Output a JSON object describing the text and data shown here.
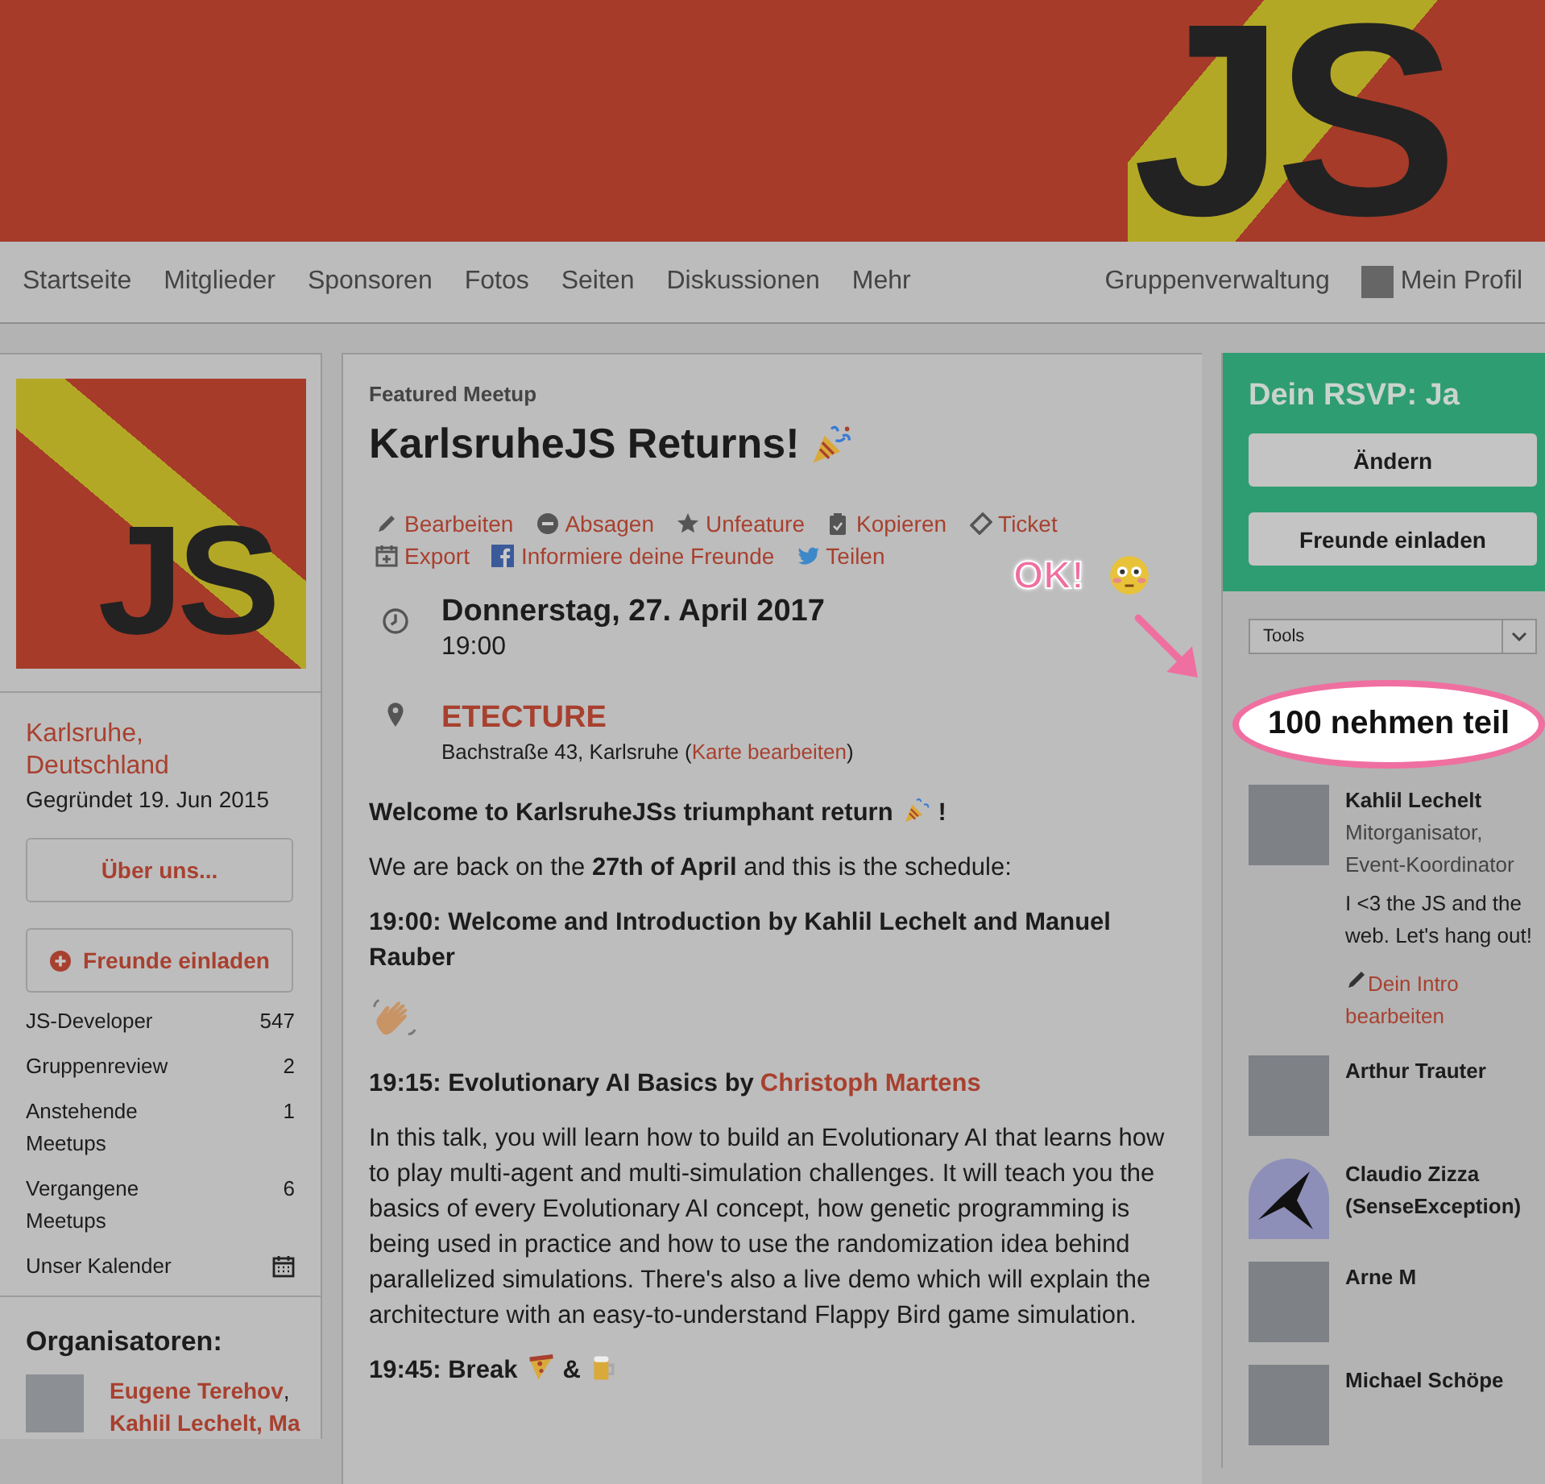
{
  "banner": {
    "logo_text": "JS"
  },
  "nav": {
    "items": [
      "Startseite",
      "Mitglieder",
      "Sponsoren",
      "Fotos",
      "Seiten",
      "Diskussionen",
      "Mehr"
    ],
    "admin": "Gruppenverwaltung",
    "profile": "Mein Profil"
  },
  "group": {
    "logo_text": "JS",
    "location": "Karlsruhe, Deutschland",
    "founded": "Gegründet 19. Jun 2015",
    "about_button": "Über uns...",
    "invite_button": "Freunde einladen",
    "stats": [
      {
        "kind": "count",
        "label": "JS-Developer",
        "value": "547"
      },
      {
        "kind": "count",
        "label": "Gruppenreview",
        "value": "2"
      },
      {
        "kind": "count",
        "label": "Anstehende Meetups",
        "value": "1"
      },
      {
        "kind": "count",
        "label": "Vergangene Meetups",
        "value": "6"
      },
      {
        "kind": "calendar",
        "label": "Unser Kalender"
      }
    ],
    "organizers": {
      "title": "Organisatoren:",
      "people": [
        "Eugene Terehov",
        "Kahlil Lechelt, Ma"
      ],
      "separator": ","
    }
  },
  "event": {
    "label": "Featured Meetup",
    "title": "KarlsruheJS Returns!",
    "actions": [
      {
        "kind": "edit",
        "label": "Bearbeiten"
      },
      {
        "kind": "cancel",
        "label": "Absagen"
      },
      {
        "kind": "unfeature",
        "label": "Unfeature"
      },
      {
        "kind": "copy",
        "label": "Kopieren"
      },
      {
        "kind": "ticket",
        "label": "Ticket"
      },
      {
        "kind": "export",
        "label": "Export"
      },
      {
        "kind": "facebook",
        "label": "Informiere deine Freunde"
      },
      {
        "kind": "twitter",
        "label": "Teilen"
      }
    ],
    "date": "Donnerstag, 27. April 2017",
    "time": "19:00",
    "venue": "ETECTURE",
    "address": "Bachstraße 43, Karlsruhe (",
    "map_link": "Karte bearbeiten",
    "address_end": ")",
    "blocks": [
      {
        "kind": "heading",
        "parts": [
          {
            "kind": "text",
            "text": "Welcome to KarlsruheJSs triumphant return"
          },
          {
            "kind": "party"
          },
          {
            "kind": "text",
            "text": "!"
          }
        ]
      },
      {
        "kind": "text",
        "text": "We are back on the **27th of April** and this is the schedule:"
      },
      {
        "kind": "heading",
        "parts": [
          {
            "kind": "text",
            "text": "19:00: Welcome and Introduction by Kahlil Lechelt and Manuel Rauber"
          }
        ]
      },
      {
        "kind": "emoji"
      },
      {
        "kind": "heading",
        "parts": [
          {
            "kind": "text",
            "text": "19:15: Evolutionary AI Basics by"
          },
          {
            "kind": "link",
            "text": "Christoph Martens"
          }
        ]
      },
      {
        "kind": "text",
        "text": "In this talk, you will learn how to build an Evolutionary AI that learns how to play multi-agent and multi-simulation challenges. It will teach you the basics of every Evolutionary AI concept, how genetic programming is being used in practice and how to use the randomization idea behind parallelized simulations. There's also a live demo which will explain the architecture with an easy-to-understand Flappy Bird game simulation."
      },
      {
        "kind": "heading",
        "parts": [
          {
            "kind": "text",
            "text": "19:45: Break"
          },
          {
            "kind": "pizza"
          },
          {
            "kind": "text",
            "text": "&"
          },
          {
            "kind": "beer"
          }
        ]
      }
    ]
  },
  "annotation": {
    "text": "OK!"
  },
  "rsvp": {
    "title": "Dein RSVP: Ja",
    "buttons": [
      "Ändern",
      "Freunde einladen"
    ]
  },
  "tools": {
    "value": "Tools"
  },
  "attendees": {
    "count": "100 nehmen teil",
    "people": [
      {
        "kind": "photo",
        "name": "Kahlil Lechelt",
        "role": "Mitorganisator, Event-Koordinator",
        "bio": "I <3 the JS and the web. Let's hang out!",
        "intro_link": "Dein Intro bearbeiten"
      },
      {
        "kind": "photo",
        "name": "Arthur Trauter"
      },
      {
        "kind": "bird",
        "name": "Claudio Zizza (SenseException)"
      },
      {
        "kind": "photo",
        "name": "Arne M"
      },
      {
        "kind": "photo",
        "name": "Michael Schöpe"
      }
    ]
  }
}
